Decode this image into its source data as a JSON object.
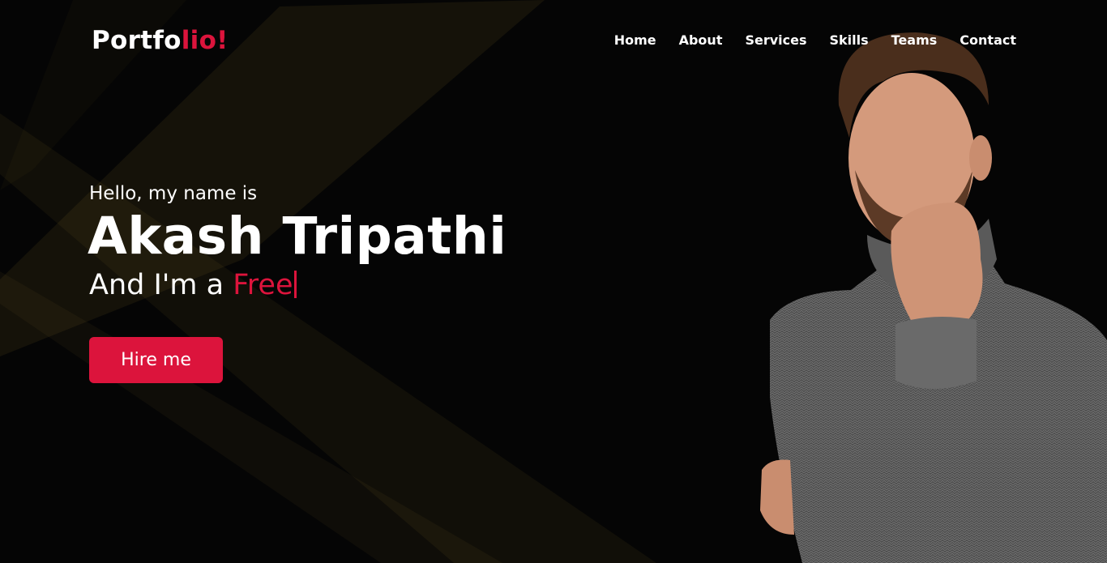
{
  "logo": {
    "text_main": "Portfo",
    "text_accent": "lio!"
  },
  "nav": {
    "home": "Home",
    "about": "About",
    "services": "Services",
    "skills": "Skills",
    "teams": "Teams",
    "contact": "Contact"
  },
  "hero": {
    "greeting": "Hello, my name is",
    "name": "Akash Tripathi",
    "role_prefix": "And I'm a ",
    "role_typed": "Free",
    "cta_label": "Hire me"
  },
  "colors": {
    "accent": "#dc143c",
    "background": "#050505",
    "text": "#ffffff",
    "ray": "#b89a3c"
  },
  "icons": {
    "typing_cursor": "text-cursor-icon"
  }
}
